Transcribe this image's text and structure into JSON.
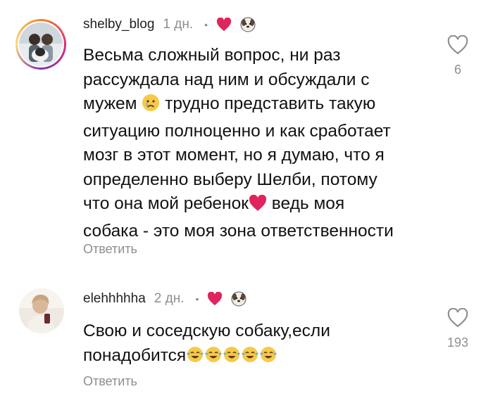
{
  "comments": [
    {
      "username": "shelby_blog",
      "time": "1 дн.",
      "dot": "•",
      "text_lines": [
        "Весьма сложный вопрос, ни раз",
        "рассуждала над ним и обсуждали с",
        "мужем",
        "трудно представить такую",
        "ситуацию полноценно и как сработает",
        "мозг в этот момент, но я думаю, что я",
        "определенно выберу Шелби, потому",
        "что она мой ребенок",
        "ведь моя",
        "собака - это моя зона ответственности"
      ],
      "reply_label": "Ответить",
      "likes": "6"
    },
    {
      "username": "elehhhhha",
      "time": "2 дн.",
      "dot": "•",
      "text_lines": [
        "Свою и соседскую собаку,если",
        "понадобится"
      ],
      "reply_label": "Ответить",
      "likes": "193"
    }
  ],
  "colors": {
    "heart_red": "#e0245e",
    "muted": "#8e8e8e"
  },
  "icons": [
    "red-heart-icon",
    "dog-face-icon",
    "heart-outline-icon",
    "sad-face-emoji",
    "red-heart-emoji",
    "tears-of-joy-emoji"
  ]
}
